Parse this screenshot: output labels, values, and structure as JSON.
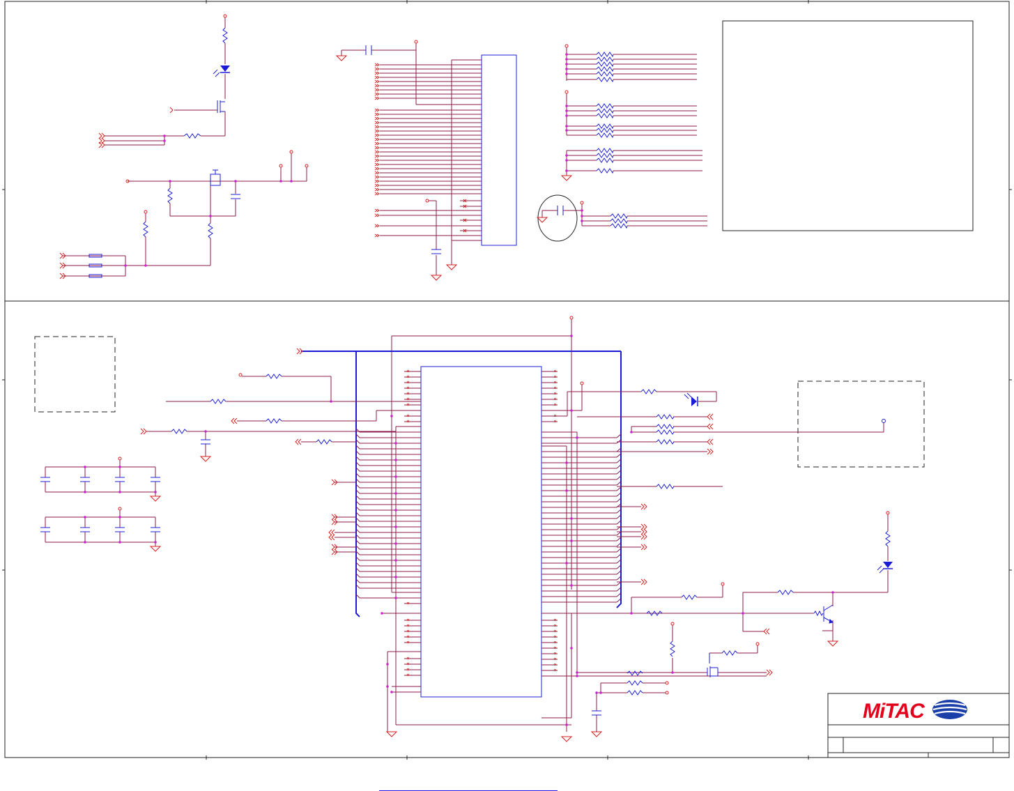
{
  "title_block": {
    "company_logo_text": "MiTAC"
  },
  "footer": {
    "link_text": ""
  },
  "colors": {
    "wire": "#8b1a4a",
    "signal": "#d81e1e",
    "bus": "#1b1bd6",
    "component": "#1b1bd6",
    "node": "#cc22cc",
    "frame": "#222222",
    "logo_red": "#e2001a",
    "logo_blue": "#1b3fa8"
  }
}
